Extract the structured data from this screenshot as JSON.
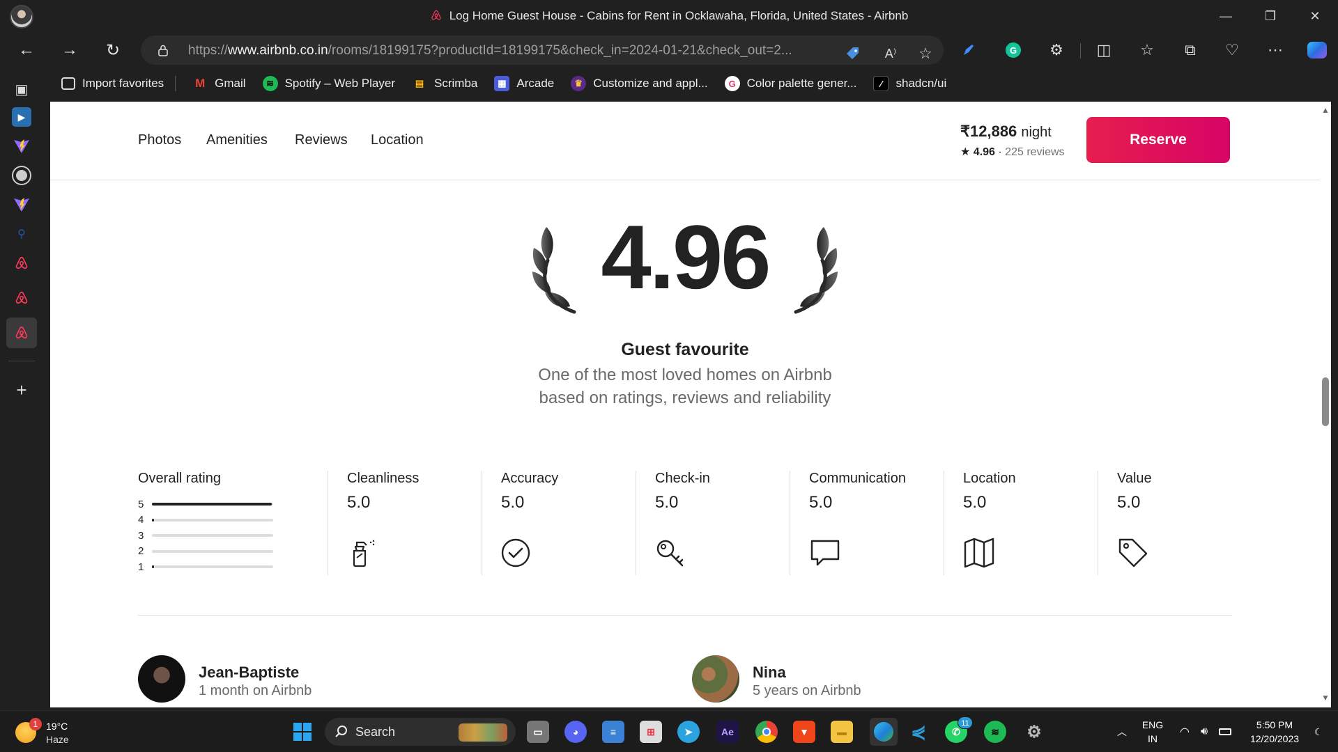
{
  "window": {
    "title": "Log Home Guest House - Cabins for Rent in Ocklawaha, Florida, United States - Airbnb"
  },
  "address_bar": {
    "url_prefix": "https://",
    "url_host": "www.airbnb.co.in",
    "url_path": "/rooms/18199175?productId=18199175&check_in=2024-01-21&check_out=2..."
  },
  "favorites": [
    {
      "label": "Import favorites",
      "icon": "import-favorites-icon"
    },
    {
      "label": "Gmail",
      "icon": "gmail-icon"
    },
    {
      "label": "Spotify – Web Player",
      "icon": "spotify-icon"
    },
    {
      "label": "Scrimba",
      "icon": "scrimba-icon"
    },
    {
      "label": "Arcade",
      "icon": "arcade-icon"
    },
    {
      "label": "Customize and appl...",
      "icon": "crown-icon"
    },
    {
      "label": "Color palette gener...",
      "icon": "g-icon"
    },
    {
      "label": "shadcn/ui",
      "icon": "shadcn-icon"
    }
  ],
  "sticky_nav": {
    "links": [
      "Photos",
      "Amenities",
      "Reviews",
      "Location"
    ],
    "price": "₹12,886",
    "price_unit": "night",
    "rating": "4.96",
    "rating_sep": "·",
    "reviews": "225 reviews",
    "reserve_label": "Reserve"
  },
  "rating_hero": {
    "score": "4.96",
    "badge": "Guest favourite",
    "description_line1": "One of the most loved homes on Airbnb",
    "description_line2": "based on ratings, reviews and reliability"
  },
  "overall_rating": {
    "title": "Overall rating",
    "bars": [
      {
        "stars": "5",
        "fraction": 0.99
      },
      {
        "stars": "4",
        "fraction": 0.01
      },
      {
        "stars": "3",
        "fraction": 0
      },
      {
        "stars": "2",
        "fraction": 0
      },
      {
        "stars": "1",
        "fraction": 0.01
      }
    ]
  },
  "categories": [
    {
      "label": "Cleanliness",
      "value": "5.0",
      "icon": "spray-bottle-icon"
    },
    {
      "label": "Accuracy",
      "value": "5.0",
      "icon": "check-circle-icon"
    },
    {
      "label": "Check-in",
      "value": "5.0",
      "icon": "key-icon"
    },
    {
      "label": "Communication",
      "value": "5.0",
      "icon": "chat-bubble-icon"
    },
    {
      "label": "Location",
      "value": "5.0",
      "icon": "map-icon"
    },
    {
      "label": "Value",
      "value": "5.0",
      "icon": "price-tag-icon"
    }
  ],
  "reviewers": [
    {
      "name": "Jean-Baptiste",
      "tenure": "1 month on Airbnb"
    },
    {
      "name": "Nina",
      "tenure": "5 years on Airbnb"
    }
  ],
  "taskbar": {
    "weather_temp": "19°C",
    "weather_cond": "Haze",
    "weather_badge": "1",
    "search_label": "Search",
    "whatsapp_badge": "11",
    "lang_line1": "ENG",
    "lang_line2": "IN",
    "time": "5:50 PM",
    "date": "12/20/2023"
  },
  "colors": {
    "brand": "#FF385C",
    "reserve_gradient_start": "#E61E4D",
    "reserve_gradient_end": "#D70466"
  }
}
